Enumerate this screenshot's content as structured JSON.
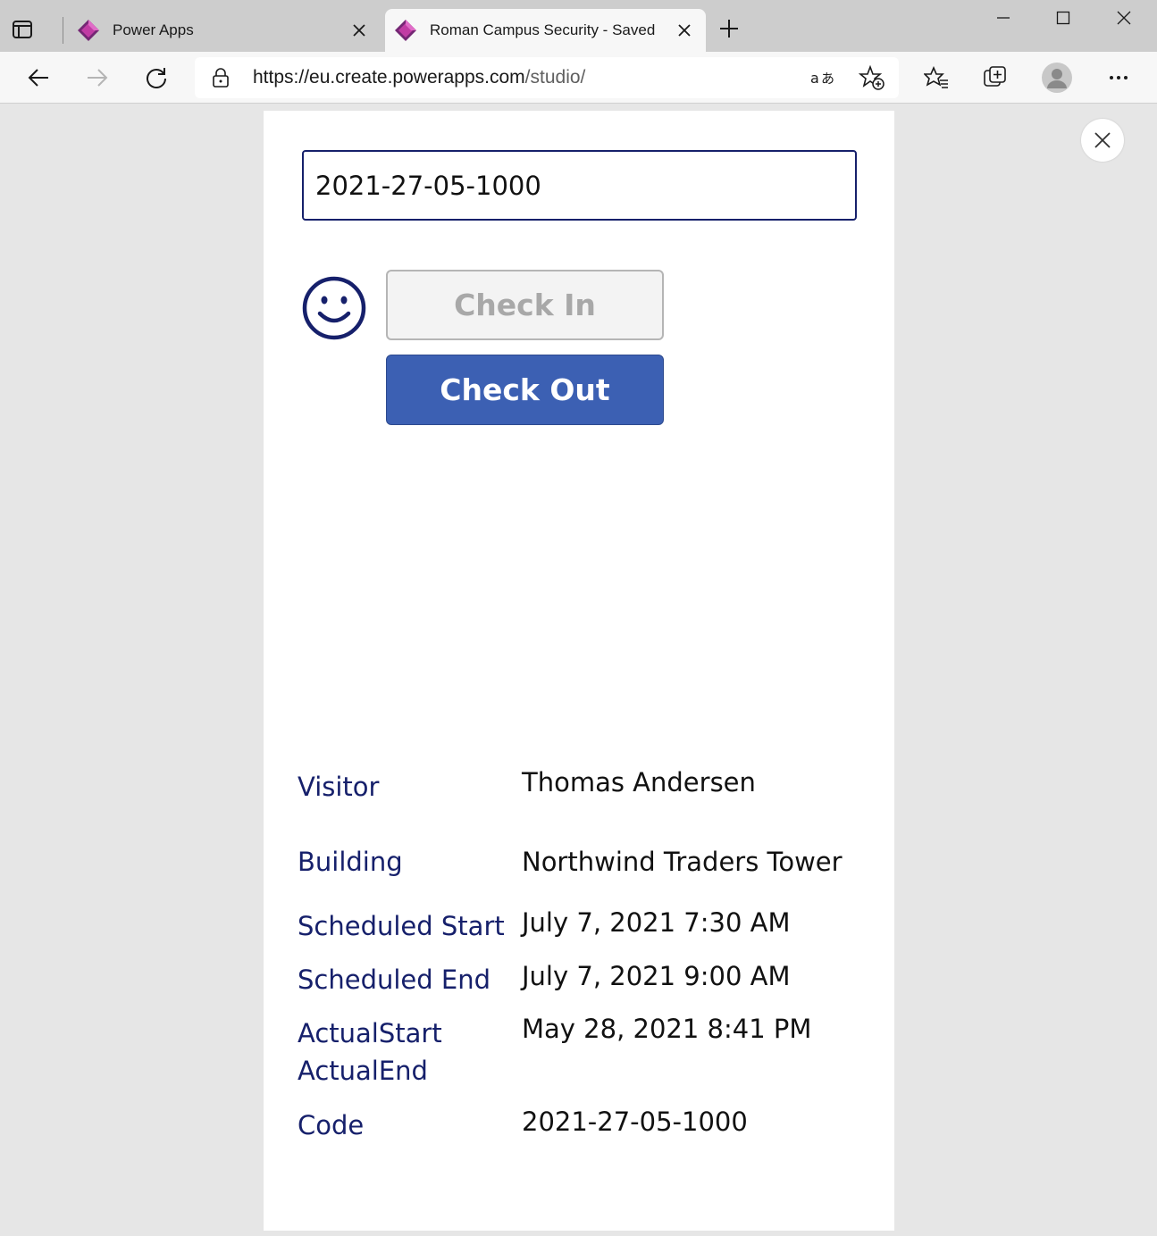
{
  "browser": {
    "tabs": [
      {
        "title": "Power Apps",
        "active": false
      },
      {
        "title": "Roman Campus Security - Saved",
        "active": true
      }
    ],
    "address": {
      "host": "https://eu.create.powerapps.com",
      "path": "/studio/"
    },
    "colors": {
      "tabstrip": "#cdcdcd",
      "toolbar": "#f7f7f7",
      "favicon": "#9b2d8f"
    },
    "icons": [
      "tab-actions-icon",
      "powerapps-icon",
      "close-icon",
      "plus-icon",
      "minimize-icon",
      "maximize-icon",
      "back-icon",
      "forward-icon",
      "refresh-icon",
      "lock-icon",
      "read-aloud-icon",
      "add-favorite-icon",
      "favorites-icon",
      "collections-icon",
      "profile-icon",
      "more-icon"
    ]
  },
  "app": {
    "code_input_value": "2021-27-05-1000",
    "smiley_icon": "smiley-face-icon",
    "checkin_label": "Check In",
    "checkout_label": "Check Out",
    "colors": {
      "label": "#16206b",
      "primary": "#3c60b3",
      "disabled_bg": "#f3f3f3",
      "disabled_text": "#a8a8a8"
    },
    "details": {
      "visitor_label": "Visitor",
      "visitor_value": "Thomas Andersen",
      "building_label": "Building",
      "building_value": "Northwind Traders Tower",
      "scheduled_start_label": "Scheduled Start",
      "scheduled_start_value": "July 7, 2021 7:30 AM",
      "scheduled_end_label": "Scheduled End",
      "scheduled_end_value": "July 7, 2021 9:00 AM",
      "actual_start_label": "ActualStart",
      "actual_start_value": "May 28, 2021 8:41 PM",
      "actual_end_label": "ActualEnd",
      "code_label": "Code",
      "code_value": "2021-27-05-1000"
    }
  }
}
